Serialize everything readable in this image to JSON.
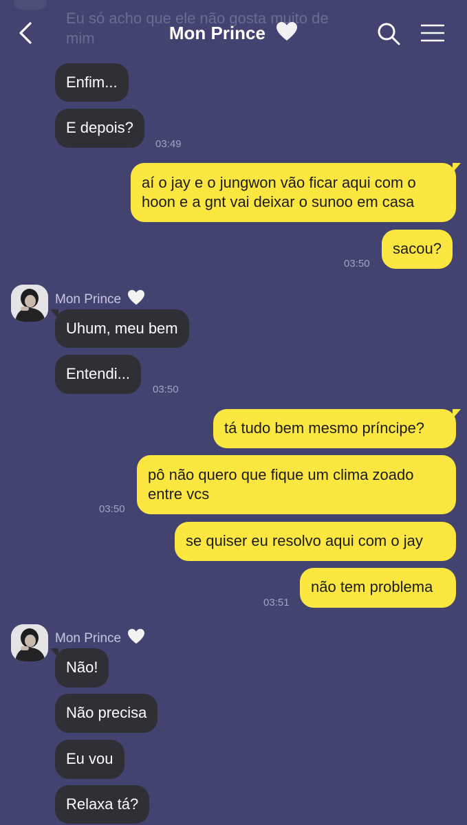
{
  "header": {
    "title": "Mon Prince",
    "faded_message": "Eu só acho que ele não gosta muito de mim"
  },
  "contact_name": "Mon Prince",
  "colors": {
    "background": "#434371",
    "incoming_bubble": "#2f2f36",
    "outgoing_bubble": "#fce741",
    "timestamp": "#a3a3c4"
  },
  "messages": [
    {
      "text": "Enfim..."
    },
    {
      "text": "E depois?",
      "time": "03:49"
    },
    {
      "text": "aí o jay e o jungwon vão ficar aqui com o"
    },
    {
      "text": "hoon e a gnt vai deixar o sunoo em casa"
    },
    {
      "text": "sacou?",
      "time": "03:50"
    },
    {
      "text": "Uhum, meu bem"
    },
    {
      "text": "Entendi...",
      "time": "03:50"
    },
    {
      "text": "tá tudo bem mesmo príncipe?"
    },
    {
      "text": "pô não quero que fique um clima zoado"
    },
    {
      "text": "entre vcs",
      "time": "03:50"
    },
    {
      "text": "se quiser eu resolvo aqui com o jay"
    },
    {
      "text": "não tem problema",
      "time": "03:51"
    },
    {
      "text": "Não!"
    },
    {
      "text": "Não precisa"
    },
    {
      "text": "Eu vou"
    },
    {
      "text": "Relaxa tá?"
    }
  ]
}
